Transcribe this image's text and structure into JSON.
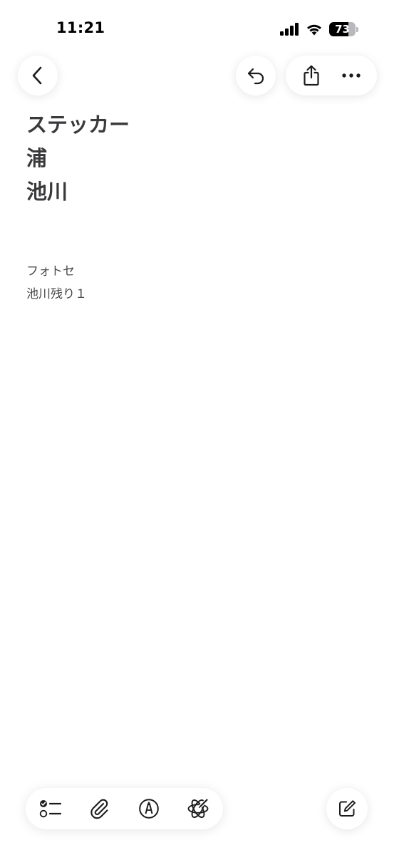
{
  "status_bar": {
    "time": "11:21",
    "battery_level": "73",
    "battery_fraction": 0.73,
    "signal_bars": 4,
    "wifi": true
  },
  "nav": {
    "back_icon": "chevron-left-icon",
    "undo_icon": "undo-icon",
    "share_icon": "share-icon",
    "more_icon": "ellipsis-icon"
  },
  "note": {
    "title_lines": [
      "ステッカー",
      "浦",
      "池川"
    ],
    "body_lines": [
      "フォトセ",
      "池川残り１"
    ]
  },
  "toolbar": {
    "items": [
      {
        "icon": "checklist-icon"
      },
      {
        "icon": "paperclip-icon"
      },
      {
        "icon": "markup-pen-icon"
      },
      {
        "icon": "writing-tools-icon"
      }
    ],
    "compose_icon": "compose-icon"
  },
  "colors": {
    "background": "#ffffff",
    "title_text": "#3a3a3c",
    "body_text": "#48484a",
    "icon": "#1c1c1e"
  }
}
